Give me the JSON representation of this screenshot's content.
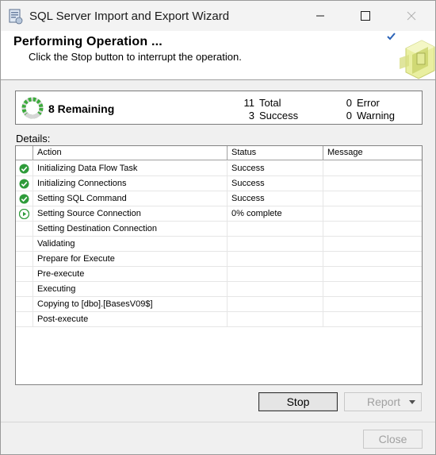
{
  "window": {
    "title": "SQL Server Import and Export Wizard"
  },
  "header": {
    "title": "Performing Operation ...",
    "subtitle": "Click the Stop button to interrupt the operation."
  },
  "summary": {
    "remaining_label": "8 Remaining",
    "total": {
      "value": "11",
      "label": "Total"
    },
    "success": {
      "value": "3",
      "label": "Success"
    },
    "error": {
      "value": "0",
      "label": "Error"
    },
    "warning": {
      "value": "0",
      "label": "Warning"
    }
  },
  "details": {
    "label": "Details:",
    "columns": {
      "action": "Action",
      "status": "Status",
      "message": "Message"
    },
    "rows": [
      {
        "icon": "success-icon",
        "action": "Initializing Data Flow Task",
        "status": "Success",
        "message": ""
      },
      {
        "icon": "success-icon",
        "action": "Initializing Connections",
        "status": "Success",
        "message": ""
      },
      {
        "icon": "success-icon",
        "action": "Setting SQL Command",
        "status": "Success",
        "message": ""
      },
      {
        "icon": "in-progress-icon",
        "action": "Setting Source Connection",
        "status": "0% complete",
        "message": ""
      },
      {
        "icon": "",
        "action": "Setting Destination Connection",
        "status": "",
        "message": ""
      },
      {
        "icon": "",
        "action": "Validating",
        "status": "",
        "message": ""
      },
      {
        "icon": "",
        "action": "Prepare for Execute",
        "status": "",
        "message": ""
      },
      {
        "icon": "",
        "action": "Pre-execute",
        "status": "",
        "message": ""
      },
      {
        "icon": "",
        "action": "Executing",
        "status": "",
        "message": ""
      },
      {
        "icon": "",
        "action": "Copying to [dbo].[BasesV09$]",
        "status": "",
        "message": ""
      },
      {
        "icon": "",
        "action": "Post-execute",
        "status": "",
        "message": ""
      }
    ]
  },
  "buttons": {
    "stop": "Stop",
    "report": "Report",
    "close": "Close"
  },
  "colors": {
    "success_green": "#2e9b3a",
    "window_bg": "#f0f0f0",
    "disabled_text": "#a0a0a0"
  }
}
